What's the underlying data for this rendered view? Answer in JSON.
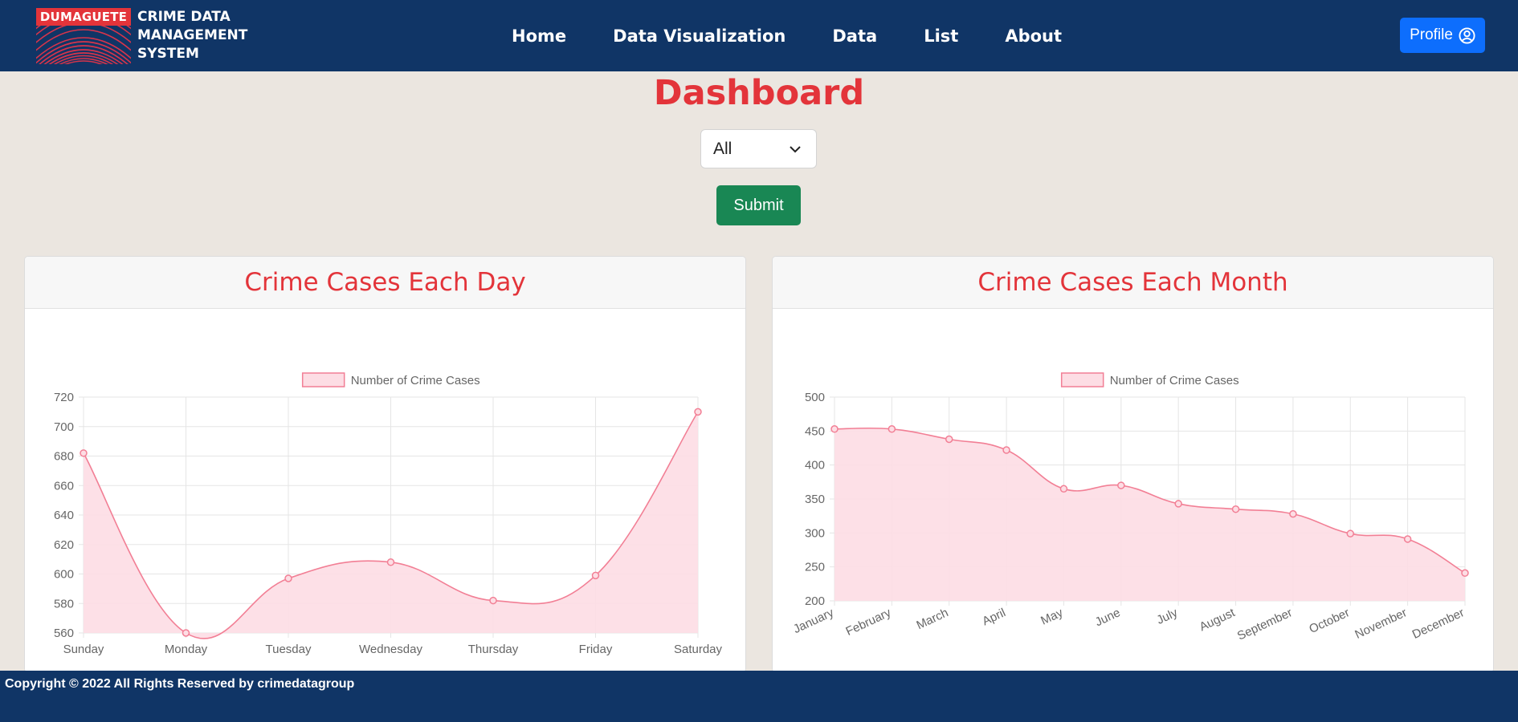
{
  "app": {
    "logo_tag": "DUMAGUETE",
    "brand_lines": [
      "CRIME DATA",
      "MANAGEMENT",
      "SYSTEM"
    ]
  },
  "nav": {
    "items": [
      {
        "label": "Home"
      },
      {
        "label": "Data Visualization"
      },
      {
        "label": "Data"
      },
      {
        "label": "List"
      },
      {
        "label": "About"
      }
    ],
    "profile_label": "Profile",
    "profile_icon": "user-circle-icon"
  },
  "page": {
    "title": "Dashboard",
    "filter_value": "All",
    "submit_label": "Submit"
  },
  "colors": {
    "navbar": "#103566",
    "accent_red": "#e3343a",
    "primary_blue": "#0d6efd",
    "success_green": "#198754",
    "series_line": "#f27f95",
    "series_fill": "#fddde4"
  },
  "chart_data": [
    {
      "type": "area",
      "title": "Crime Cases Each Day",
      "categories": [
        "Sunday",
        "Monday",
        "Tuesday",
        "Wednesday",
        "Thursday",
        "Friday",
        "Saturday"
      ],
      "series": [
        {
          "name": "Number of Crime Cases",
          "values": [
            682,
            560,
            597,
            608,
            582,
            599,
            710
          ]
        }
      ],
      "ylim": [
        560,
        720
      ],
      "yticks": [
        560,
        580,
        600,
        620,
        640,
        660,
        680,
        700,
        720
      ],
      "grid": true,
      "legend": "top-center"
    },
    {
      "type": "area",
      "title": "Crime Cases Each Month",
      "categories": [
        "January",
        "February",
        "March",
        "April",
        "May",
        "June",
        "July",
        "August",
        "September",
        "October",
        "November",
        "December"
      ],
      "series": [
        {
          "name": "Number of Crime Cases",
          "values": [
            453,
            453,
            438,
            422,
            365,
            370,
            343,
            335,
            328,
            299,
            291,
            241
          ]
        }
      ],
      "ylim": [
        200,
        500
      ],
      "yticks": [
        200,
        250,
        300,
        350,
        400,
        450,
        500
      ],
      "grid": true,
      "legend": "top-center"
    }
  ],
  "footer": {
    "text": "Copyright © 2022 All Rights Reserved by crimedatagroup"
  }
}
